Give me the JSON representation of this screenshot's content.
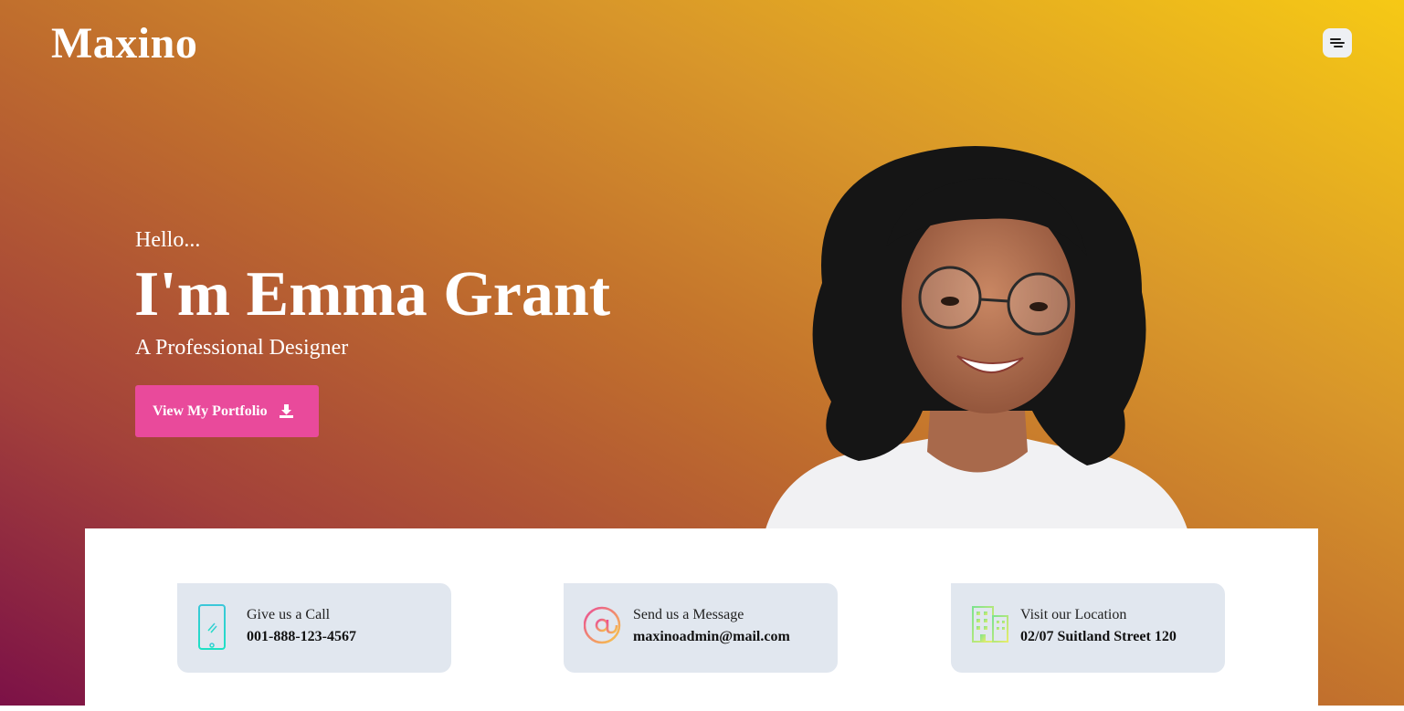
{
  "brand": {
    "logo": "Maxino"
  },
  "nav": {
    "menu_icon": "hamburger-menu-icon"
  },
  "hero": {
    "greeting": "Hello...",
    "name": "I'm Emma Grant",
    "role": "A Professional Designer",
    "cta_label": "View My Portfolio",
    "cta_icon": "download-icon",
    "cta_color": "#e94a9b",
    "gradient": [
      "#7c1147",
      "#c06e2d",
      "#f6c915"
    ]
  },
  "contacts": [
    {
      "icon": "smartphone-icon",
      "title": "Give us a Call",
      "value": "001-888-123-4567"
    },
    {
      "icon": "at-sign-icon",
      "title": "Send us a Message",
      "value": "maxinoadmin@mail.com"
    },
    {
      "icon": "building-icon",
      "title": "Visit our Location",
      "value": "02/07 Suitland Street 120"
    }
  ]
}
